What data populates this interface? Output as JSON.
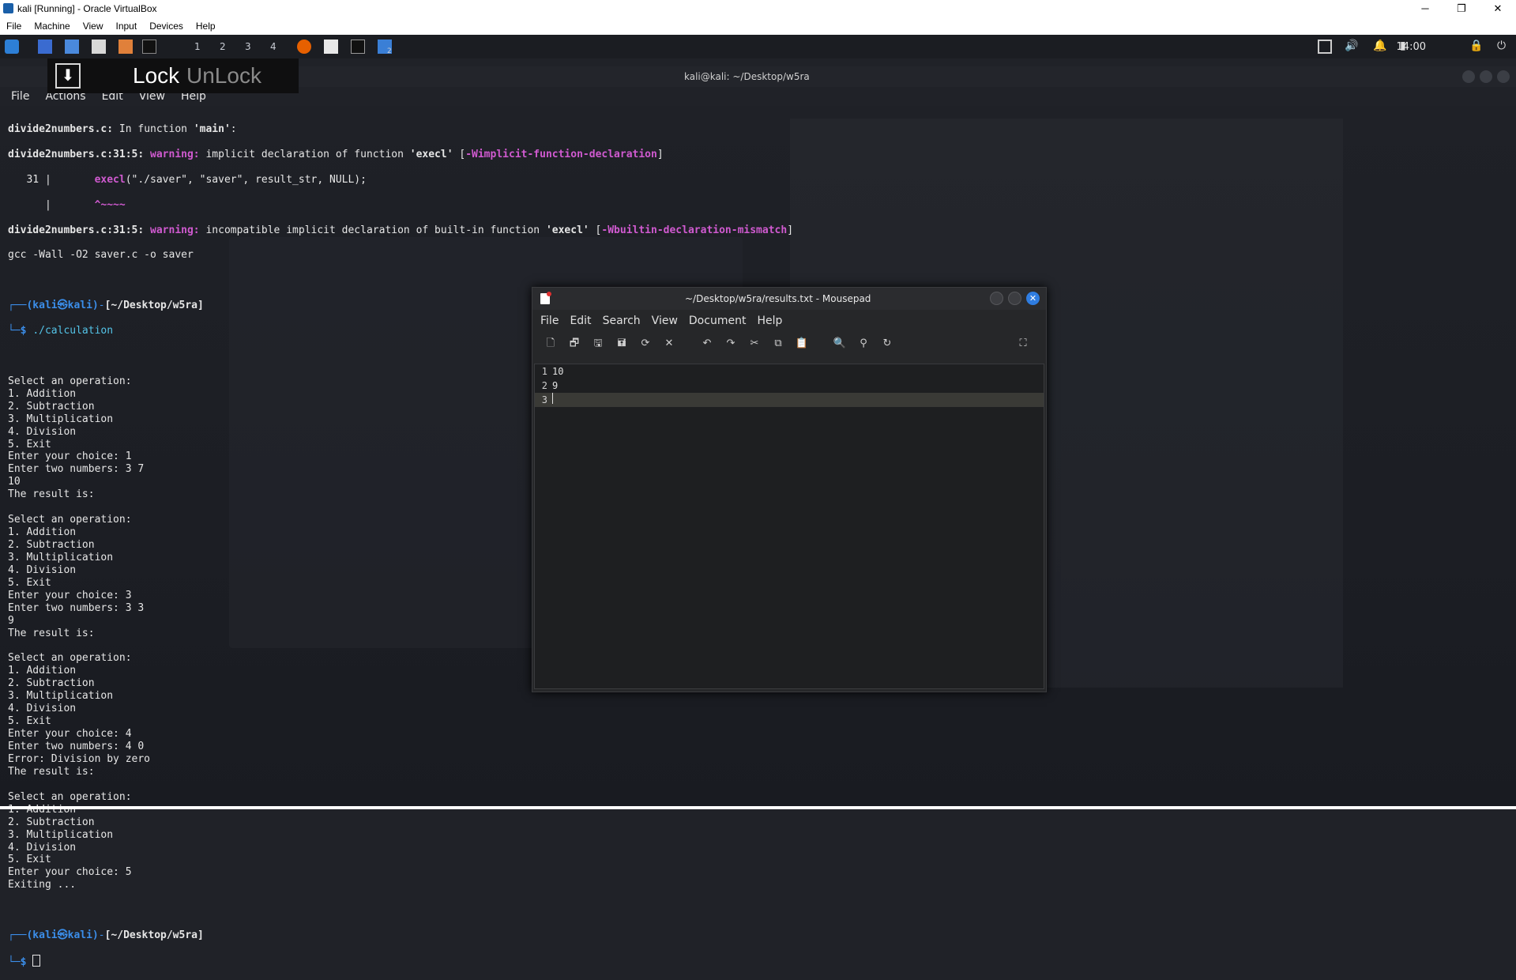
{
  "vbox": {
    "title": "kali [Running] - Oracle VirtualBox",
    "menu": [
      "File",
      "Machine",
      "View",
      "Input",
      "Devices",
      "Help"
    ],
    "controls": [
      "─",
      "❐",
      "✕"
    ]
  },
  "panel": {
    "workspaces": [
      "1",
      "2",
      "3",
      "4"
    ],
    "clock": "14:00",
    "badge": "2"
  },
  "lockbar": {
    "lock": "Lock",
    "unlock": "UnLock"
  },
  "terminal": {
    "window_title": "kali@kali: ~/Desktop/w5ra",
    "menu": [
      "File",
      "Actions",
      "Edit",
      "View",
      "Help"
    ],
    "lines": {
      "l1a": "divide2numbers.c:",
      "l1b": " In function ",
      "l1c": "'main'",
      "l1d": ":",
      "l2a": "divide2numbers.c:31:5: ",
      "l2b": "warning: ",
      "l2c": "implicit declaration of function ",
      "l2d": "'execl'",
      "l2e": " [",
      "l2f": "-Wimplicit-function-declaration",
      "l2g": "]",
      "l3a": "   31 |       ",
      "l3b": "execl",
      "l3c": "(\"./saver\", \"saver\", result_str, NULL);",
      "l4a": "      |       ",
      "l4b": "^~~~~",
      "l5a": "divide2numbers.c:31:5: ",
      "l5b": "warning: ",
      "l5c": "incompatible implicit declaration of built-in function ",
      "l5d": "'execl'",
      "l5e": " [",
      "l5f": "-Wbuiltin-declaration-mismatch",
      "l5g": "]",
      "l6": "gcc -Wall -O2 saver.c -o saver",
      "prompt_user": "(kali㉿kali)",
      "prompt_dir": "[~/Desktop/w5ra]",
      "cmd1": "./calculation",
      "body": [
        "Select an operation:",
        "1. Addition",
        "2. Subtraction",
        "3. Multiplication",
        "4. Division",
        "5. Exit",
        "Enter your choice: 1",
        "Enter two numbers: 3 7",
        "10",
        "The result is:",
        "",
        "Select an operation:",
        "1. Addition",
        "2. Subtraction",
        "3. Multiplication",
        "4. Division",
        "5. Exit",
        "Enter your choice: 3",
        "Enter two numbers: 3 3",
        "9",
        "The result is:",
        "",
        "Select an operation:",
        "1. Addition",
        "2. Subtraction",
        "3. Multiplication",
        "4. Division",
        "5. Exit",
        "Enter your choice: 4",
        "Enter two numbers: 4 0",
        "Error: Division by zero",
        "The result is:",
        "",
        "Select an operation:",
        "1. Addition",
        "2. Subtraction",
        "3. Multiplication",
        "4. Division",
        "5. Exit",
        "Enter your choice: 5",
        "Exiting ..."
      ]
    }
  },
  "mousepad": {
    "title": "~/Desktop/w5ra/results.txt - Mousepad",
    "menu": [
      "File",
      "Edit",
      "Search",
      "View",
      "Document",
      "Help"
    ],
    "lines": [
      {
        "num": "1",
        "text": "10"
      },
      {
        "num": "2",
        "text": "9"
      },
      {
        "num": "3",
        "text": ""
      }
    ]
  }
}
